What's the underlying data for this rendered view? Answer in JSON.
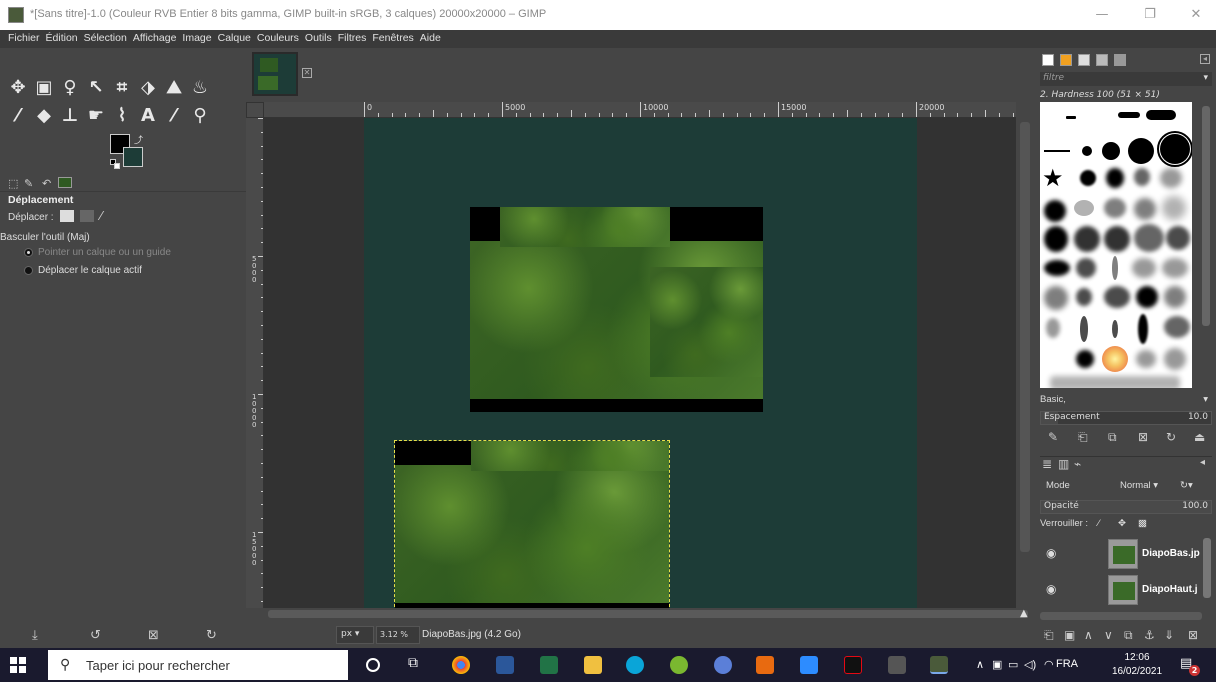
{
  "window": {
    "title": "*[Sans titre]-1.0 (Couleur RVB Entier 8 bits gamma, GIMP built-in sRGB, 3 calques) 20000x20000 – GIMP",
    "minimize_glyph": "—",
    "maximize_glyph": "❐",
    "close_glyph": "✕"
  },
  "menu": [
    "Fichier",
    "Édition",
    "Sélection",
    "Affichage",
    "Image",
    "Calque",
    "Couleurs",
    "Outils",
    "Filtres",
    "Fenêtres",
    "Aide"
  ],
  "tool_options": {
    "title": "Déplacement",
    "move_label": "Déplacer :",
    "toggle_label": "Basculer l'outil (Maj)",
    "option1": "Pointer un calque ou un guide",
    "option2": "Déplacer le calque actif"
  },
  "ruler": {
    "h_labels": [
      "0",
      "5000",
      "10000",
      "15000",
      "20000"
    ],
    "v_labels": [
      "5000",
      "10000",
      "15000"
    ]
  },
  "status": {
    "unit": "px",
    "zoom": "3.12 %",
    "info": "DiapoBas.jpg (4.2 Go)"
  },
  "brushes": {
    "filter_placeholder": "filtre",
    "current": "2. Hardness 100 (51 × 51)",
    "preset": "Basic,",
    "spacing_label": "Espacement",
    "spacing_value": "10.0"
  },
  "layers": {
    "mode_label": "Mode",
    "mode_value": "Normal",
    "opacity_label": "Opacité",
    "opacity_value": "100.0",
    "lock_label": "Verrouiller :",
    "items": [
      {
        "name": "DiapoBas.jp"
      },
      {
        "name": "DiapoHaut.j"
      }
    ]
  },
  "taskbar": {
    "search_placeholder": "Taper ici pour rechercher",
    "lang": "FRA",
    "time": "12:06",
    "date": "16/02/2021",
    "notif_count": "2"
  },
  "colors": {
    "foreground": "#000000",
    "background": "#1d3c37",
    "canvas": "#1d3c37"
  }
}
